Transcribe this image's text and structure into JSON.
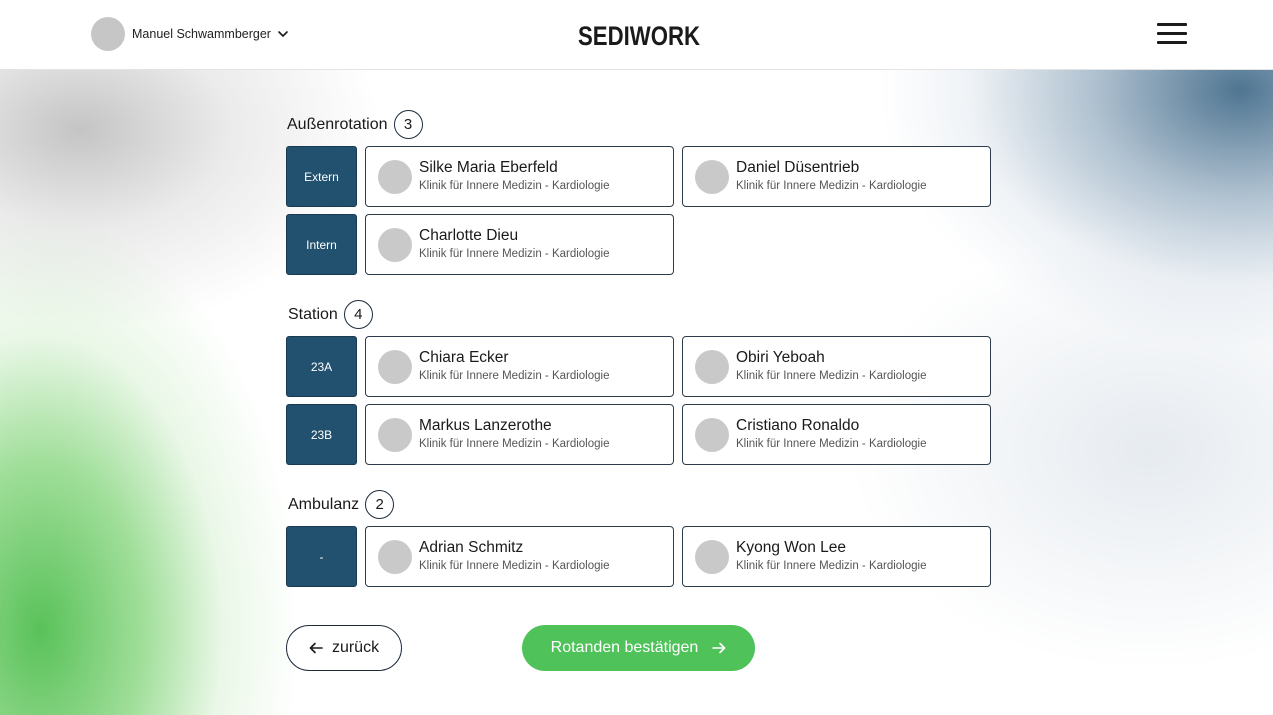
{
  "header": {
    "user_name": "Manuel Schwammberger",
    "logo_text": "SEDIWORK"
  },
  "icons": {
    "user_menu": "chevron-down-icon",
    "menu": "hamburger-menu-icon",
    "back": "arrow-left-icon",
    "confirm": "arrow-right-icon"
  },
  "colors": {
    "tag_bg": "#22506f",
    "confirm_bg": "#4fc25a",
    "avatar_placeholder": "#c9c9c9"
  },
  "sections": {
    "aussen": {
      "title": "Außenrotation",
      "count": "3",
      "rows": [
        {
          "tag": "Extern",
          "people": [
            {
              "name": "Silke Maria Eberfeld",
              "dept": "Klinik für Innere Medizin - Kardiologie"
            },
            {
              "name": "Daniel Düsentrieb",
              "dept": "Klinik für Innere Medizin - Kardiologie"
            }
          ]
        },
        {
          "tag": "Intern",
          "people": [
            {
              "name": "Charlotte Dieu",
              "dept": "Klinik für Innere Medizin - Kardiologie"
            }
          ]
        }
      ]
    },
    "station": {
      "title": "Station",
      "count": "4",
      "rows": [
        {
          "tag": "23A",
          "people": [
            {
              "name": "Chiara Ecker",
              "dept": "Klinik für Innere Medizin - Kardiologie"
            },
            {
              "name": "Obiri Yeboah",
              "dept": "Klinik für Innere Medizin - Kardiologie"
            }
          ]
        },
        {
          "tag": "23B",
          "people": [
            {
              "name": "Markus Lanzerothe",
              "dept": "Klinik für Innere Medizin - Kardiologie"
            },
            {
              "name": "Cristiano Ronaldo",
              "dept": "Klinik für Innere Medizin - Kardiologie"
            }
          ]
        }
      ]
    },
    "ambulanz": {
      "title": "Ambulanz",
      "count": "2",
      "rows": [
        {
          "tag": "-",
          "people": [
            {
              "name": "Adrian Schmitz",
              "dept": "Klinik für Innere Medizin - Kardiologie"
            },
            {
              "name": "Kyong Won Lee",
              "dept": "Klinik für Innere Medizin - Kardiologie"
            }
          ]
        }
      ]
    }
  },
  "footer": {
    "back_label": "zurück",
    "confirm_label": "Rotanden bestätigen"
  }
}
